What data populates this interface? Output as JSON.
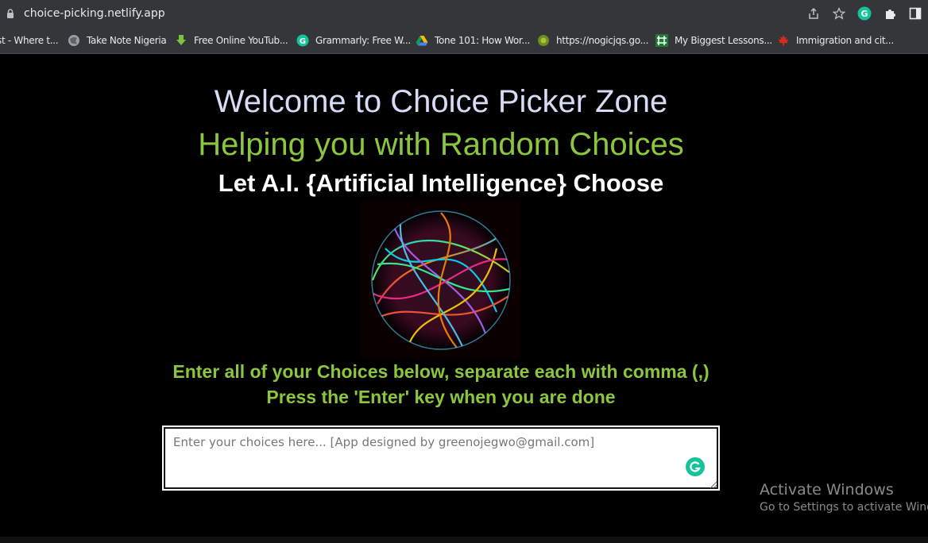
{
  "browser": {
    "url": "choice-picking.netlify.app",
    "bookmarks": [
      {
        "label": "st - Where t...",
        "icon": "page-icon"
      },
      {
        "label": "Take Note Nigeria",
        "icon": "globe-icon"
      },
      {
        "label": "Free Online YouTub...",
        "icon": "download-arrow-icon"
      },
      {
        "label": "Grammarly: Free W...",
        "icon": "grammarly-icon"
      },
      {
        "label": "Tone 101: How Wor...",
        "icon": "google-drive-icon"
      },
      {
        "label": "https://nogicjqs.go...",
        "icon": "leaf-globe-icon"
      },
      {
        "label": "My Biggest Lessons...",
        "icon": "green-grid-icon"
      },
      {
        "label": "Immigration and cit...",
        "icon": "maple-leaf-icon"
      }
    ]
  },
  "page": {
    "title": "Welcome to Choice Picker Zone",
    "subtitle": "Helping you with Random Choices",
    "tagline": "Let A.I. {Artificial Intelligence} Choose",
    "instruction_line1": "Enter all of your Choices below, separate each with comma (,)",
    "instruction_line2": "Press the 'Enter' key when you are done",
    "input_placeholder": "Enter your choices here... [App designed by greenojegwo@gmail.com]",
    "input_value": ""
  },
  "watermark": {
    "title": "Activate Windows",
    "subtitle": "Go to Settings to activate Windows."
  },
  "colors": {
    "chrome_bg": "#35363a",
    "title": "#d7dcf6",
    "accent_green": "#8cc63f",
    "page_bg": "#000000"
  }
}
